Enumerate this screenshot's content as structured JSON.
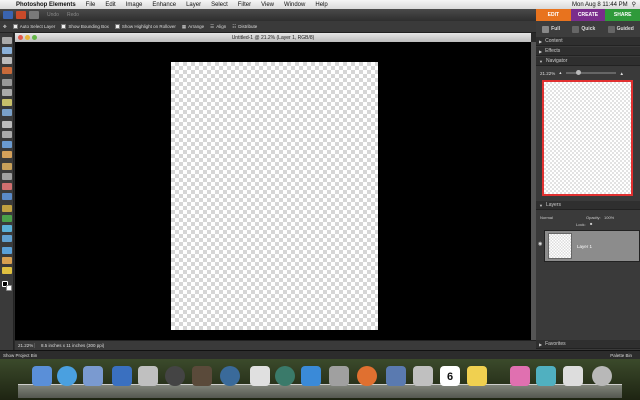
{
  "menubar": {
    "apple": "",
    "app_name": "Photoshop Elements",
    "items": [
      "File",
      "Edit",
      "Image",
      "Enhance",
      "Layer",
      "Select",
      "Filter",
      "View",
      "Window",
      "Help"
    ],
    "clock": "Mon Aug 8  11:44 PM",
    "search_icon": "search-icon"
  },
  "appbar": {
    "undo_label": "Undo",
    "redo_label": "Redo"
  },
  "mode_tabs": [
    {
      "label": "EDIT",
      "color": "#e8731e"
    },
    {
      "label": "CREATE",
      "color": "#7a2d8c"
    },
    {
      "label": "SHARE",
      "color": "#2f9a3a"
    }
  ],
  "submodes": [
    "Full",
    "Quick",
    "Guided"
  ],
  "options": {
    "auto_select_layer": "Auto Select Layer",
    "show_bounding_box": "Show Bounding Box",
    "show_highlight": "Show Highlight on Rollover",
    "arrange": "Arrange",
    "align": "Align",
    "distribute": "Distribute"
  },
  "document": {
    "title": "Untitled-1 @ 21.2% (Layer 1, RGB/8)",
    "zoom": "21.22%",
    "info": "8.5 inches x 11 inches (300 ppi)"
  },
  "panels": {
    "content": "Content",
    "effects": "Effects",
    "navigator": "Navigator",
    "nav_zoom": "21.22%",
    "layers": "Layers",
    "blend_mode": "Normal",
    "opacity_label": "Opacity:",
    "opacity_value": "100%",
    "lock_label": "Lock:",
    "layer_name": "Layer 1",
    "favorites": "Favorites"
  },
  "projectbar": {
    "show_project_bin": "Show Project Bin",
    "palette_bin": "Palette Bin"
  },
  "dock": {
    "calendar_day": "6"
  }
}
